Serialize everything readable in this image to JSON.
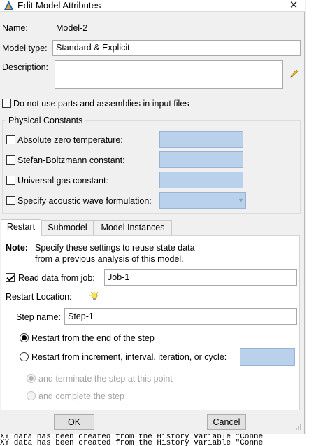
{
  "window": {
    "title": "Edit Model Attributes",
    "close_glyph": "✕"
  },
  "form": {
    "name_label": "Name:",
    "name_value": "Model-2",
    "model_type_label": "Model type:",
    "model_type_value": "Standard & Explicit",
    "description_label": "Description:",
    "description_value": "",
    "no_parts_label": "Do not use parts and assemblies in input files",
    "no_parts_checked": false
  },
  "physical_constants": {
    "title": "Physical Constants",
    "items": [
      {
        "label": "Absolute zero temperature:",
        "checked": false,
        "value": ""
      },
      {
        "label": "Stefan-Boltzmann constant:",
        "checked": false,
        "value": ""
      },
      {
        "label": "Universal gas constant:",
        "checked": false,
        "value": ""
      },
      {
        "label": "Specify acoustic wave formulation:",
        "checked": false,
        "value": ""
      }
    ]
  },
  "tabs": [
    {
      "label": "Restart",
      "active": true
    },
    {
      "label": "Submodel",
      "active": false
    },
    {
      "label": "Model Instances",
      "active": false
    }
  ],
  "restart": {
    "note_label": "Note:",
    "note_line1": "Specify these settings to reuse state data",
    "note_line2": "from a previous analysis of this model.",
    "read_job_label": "Read data from job:",
    "read_job_checked": true,
    "job_value": "Job-1",
    "location_label": "Restart Location:",
    "step_name_label": "Step name:",
    "step_name_value": "Step-1",
    "radio_end": "Restart from the end of the step",
    "radio_increment": "Restart from increment, interval, iteration, or cycle:",
    "increment_value": "",
    "sub_terminate": "and terminate the step at this point",
    "sub_complete": "and complete the step"
  },
  "buttons": {
    "ok": "OK",
    "cancel": "Cancel"
  },
  "console": {
    "line1": "XY data has been created from the History variable \"Conne",
    "line2": "XY data has been created from the History variable \"Conne"
  },
  "colors": {
    "field_blue": "#b9d1ea",
    "window_bg": "#f0f0f0"
  },
  "icons": {
    "app": "abaqus-app-icon",
    "description_edit": "pencil-icon",
    "location_hint": "lightbulb-icon"
  }
}
